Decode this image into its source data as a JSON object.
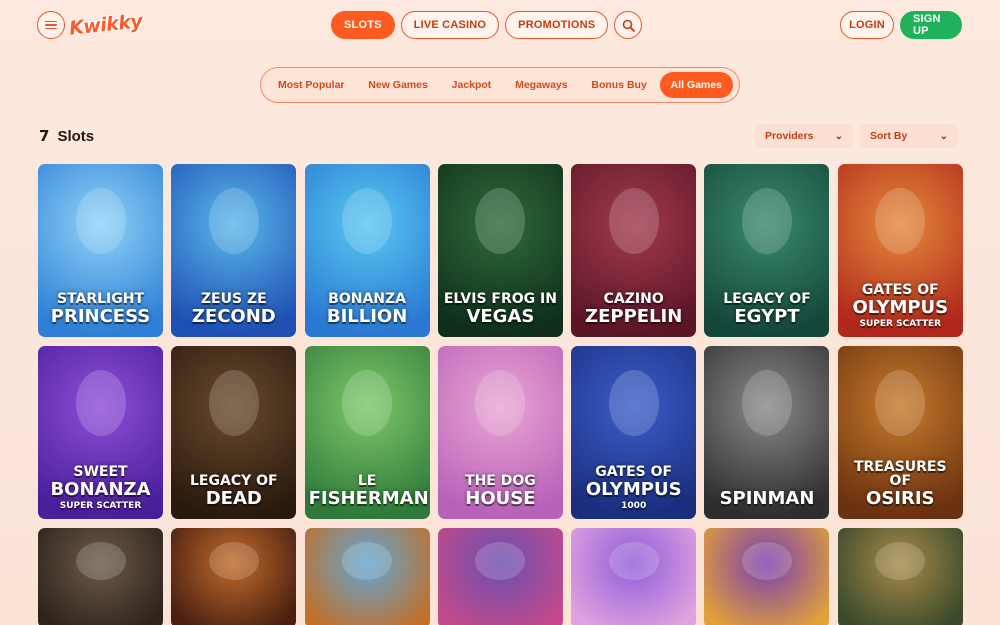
{
  "header": {
    "logo_text": "Kwikky",
    "nav": [
      {
        "label": "SLOTS",
        "active": true
      },
      {
        "label": "LIVE CASINO",
        "active": false
      },
      {
        "label": "PROMOTIONS",
        "active": false
      }
    ],
    "login_label": "LOGIN",
    "signup_label": "SIGN UP"
  },
  "categories": [
    {
      "label": "Most Popular",
      "active": false
    },
    {
      "label": "New Games",
      "active": false
    },
    {
      "label": "Jackpot",
      "active": false
    },
    {
      "label": "Megaways",
      "active": false
    },
    {
      "label": "Bonus Buy",
      "active": false
    },
    {
      "label": "All Games",
      "active": true
    }
  ],
  "section": {
    "icon": "7",
    "title": "Slots",
    "providers_label": "Providers",
    "sort_label": "Sort By"
  },
  "games": [
    {
      "l1": "STARLIGHT",
      "l2": "PRINCESS",
      "l3": "",
      "colors": [
        "#8fd3f7",
        "#2f7fd6"
      ]
    },
    {
      "l1": "ZEUS ZE",
      "l2": "ZECOND",
      "l3": "",
      "colors": [
        "#5ab8ea",
        "#1e4fb3"
      ]
    },
    {
      "l1": "BONANZA",
      "l2": "BILLION",
      "l3": "",
      "colors": [
        "#58c8f0",
        "#2a78d2"
      ]
    },
    {
      "l1": "ELVIS FROG IN",
      "l2": "VEGAS",
      "l3": "",
      "colors": [
        "#2f6b3a",
        "#0f2f1c"
      ]
    },
    {
      "l1": "CAZINO",
      "l2": "ZEPPELIN",
      "l3": "",
      "colors": [
        "#a23a4e",
        "#5b1626"
      ]
    },
    {
      "l1": "LEGACY OF",
      "l2": "EGYPT",
      "l3": "",
      "colors": [
        "#3a8a6d",
        "#14473a"
      ]
    },
    {
      "l1": "GATES OF",
      "l2": "OLYMPUS",
      "l3": "SUPER SCATTER",
      "colors": [
        "#e48a3a",
        "#b0281c"
      ]
    },
    {
      "l1": "SWEET",
      "l2": "BONANZA",
      "l3": "SUPER SCATTER",
      "colors": [
        "#8f4ed8",
        "#4a1f9c"
      ]
    },
    {
      "l1": "LEGACY OF",
      "l2": "DEAD",
      "l3": "",
      "colors": [
        "#6a4a2c",
        "#2a1a0e"
      ]
    },
    {
      "l1": "LE",
      "l2": "FISHERMAN",
      "l3": "",
      "colors": [
        "#7fc86a",
        "#2f7a3a"
      ]
    },
    {
      "l1": "THE DOG",
      "l2": "HOUSE",
      "l3": "",
      "colors": [
        "#e9a6d3",
        "#b861b9"
      ]
    },
    {
      "l1": "GATES OF",
      "l2": "OLYMPUS",
      "l3": "1000",
      "colors": [
        "#3a5fc9",
        "#1b2e7e"
      ]
    },
    {
      "l1": "",
      "l2": "SPINMAN",
      "l3": "",
      "colors": [
        "#8a8a8a",
        "#2e2e2e"
      ]
    },
    {
      "l1": "TREASURES OF",
      "l2": "OSIRIS",
      "l3": "",
      "colors": [
        "#c77a2a",
        "#6b3210"
      ]
    },
    {
      "l1": "",
      "l2": "",
      "l3": "",
      "colors": [
        "#6b5a4a",
        "#2f241c"
      ]
    },
    {
      "l1": "",
      "l2": "",
      "l3": "",
      "colors": [
        "#c06a2c",
        "#4a2010"
      ]
    },
    {
      "l1": "",
      "l2": "",
      "l3": "",
      "colors": [
        "#5fa7d6",
        "#c0702a"
      ]
    },
    {
      "l1": "",
      "l2": "",
      "l3": "",
      "colors": [
        "#6a4fb0",
        "#c34a8a"
      ]
    },
    {
      "l1": "",
      "l2": "",
      "l3": "",
      "colors": [
        "#8f5ed8",
        "#e0a2e0"
      ]
    },
    {
      "l1": "",
      "l2": "",
      "l3": "",
      "colors": [
        "#7a3fb0",
        "#e0a03a"
      ]
    },
    {
      "l1": "",
      "l2": "",
      "l3": "",
      "colors": [
        "#a88a4a",
        "#3a4a2a"
      ]
    }
  ]
}
